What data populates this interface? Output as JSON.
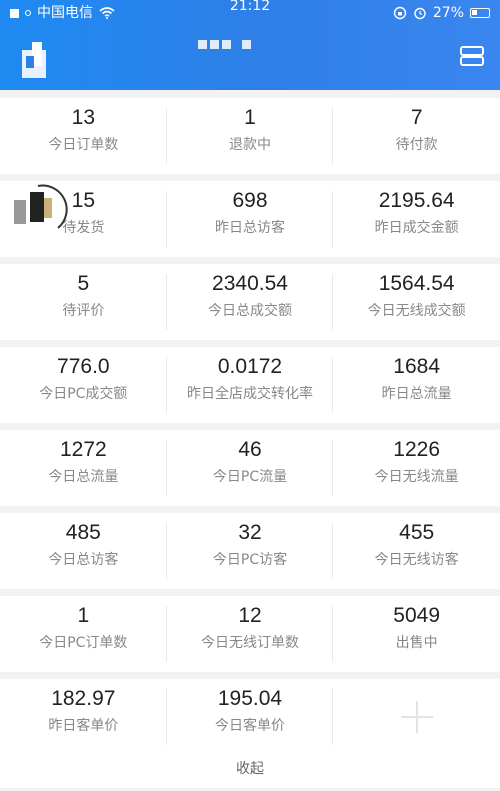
{
  "status_bar": {
    "carrier": "中国电信",
    "time": "21:12",
    "battery": "27%"
  },
  "icons": {
    "wifi": "wifi-icon",
    "lock": "rotation-lock-icon",
    "alarm": "alarm-icon",
    "menu": "menu-icon",
    "add": "plus-icon"
  },
  "stats": [
    {
      "value": "13",
      "label": "今日订单数"
    },
    {
      "value": "1",
      "label": "退款中"
    },
    {
      "value": "7",
      "label": "待付款"
    },
    {
      "value": "15",
      "label": "待发货"
    },
    {
      "value": "698",
      "label": "昨日总访客"
    },
    {
      "value": "2195.64",
      "label": "昨日成交金额"
    },
    {
      "value": "5",
      "label": "待评价"
    },
    {
      "value": "2340.54",
      "label": "今日总成交额"
    },
    {
      "value": "1564.54",
      "label": "今日无线成交额"
    },
    {
      "value": "776.0",
      "label": "今日PC成交额"
    },
    {
      "value": "0.0172",
      "label": "昨日全店成交转化率"
    },
    {
      "value": "1684",
      "label": "昨日总流量"
    },
    {
      "value": "1272",
      "label": "今日总流量"
    },
    {
      "value": "46",
      "label": "今日PC流量"
    },
    {
      "value": "1226",
      "label": "今日无线流量"
    },
    {
      "value": "485",
      "label": "今日总访客"
    },
    {
      "value": "32",
      "label": "今日PC访客"
    },
    {
      "value": "455",
      "label": "今日无线访客"
    },
    {
      "value": "1",
      "label": "今日PC订单数"
    },
    {
      "value": "12",
      "label": "今日无线订单数"
    },
    {
      "value": "5049",
      "label": "出售中"
    },
    {
      "value": "182.97",
      "label": "昨日客单价"
    },
    {
      "value": "195.04",
      "label": "今日客单价"
    }
  ],
  "collapse_label": "收起",
  "colors": {
    "header_blue": "#2f7fe6",
    "page_bg": "#f2f2f2",
    "value_text": "#222222",
    "label_text": "#888888"
  }
}
